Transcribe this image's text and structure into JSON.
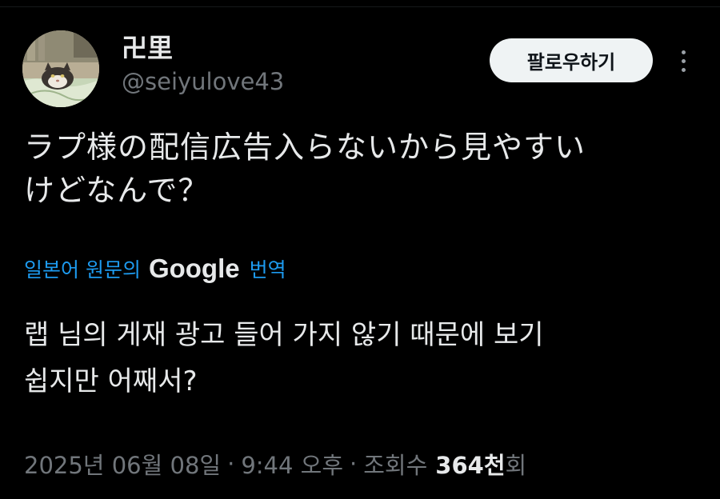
{
  "user": {
    "display_name": "卍里",
    "handle": "@seiyulove43",
    "avatar_icon": "cat-photo-avatar"
  },
  "actions": {
    "follow_label": "팔로우하기",
    "more_icon": "more-vertical-icon"
  },
  "tweet": {
    "original_line1": "ラプ様の配信広告入らないから見やすい",
    "original_line2": "けどなんで？"
  },
  "translation": {
    "prefix": "일본어 원문의",
    "brand": "Google",
    "suffix": "번역",
    "line1": "랩 님의 게재 광고 들어 가지 않기 때문에 보기",
    "line2": "쉽지만 어째서?"
  },
  "meta": {
    "date": "2025년 06월 08일",
    "separator": "·",
    "time": "9:44 오후",
    "views_count": "364천",
    "views_label": "조회수",
    "views_suffix": "회"
  },
  "colors": {
    "background": "#000000",
    "text_primary": "#e7e9ea",
    "text_secondary": "#71767b",
    "link": "#1d9bf0",
    "button_bg": "#eff3f4"
  }
}
